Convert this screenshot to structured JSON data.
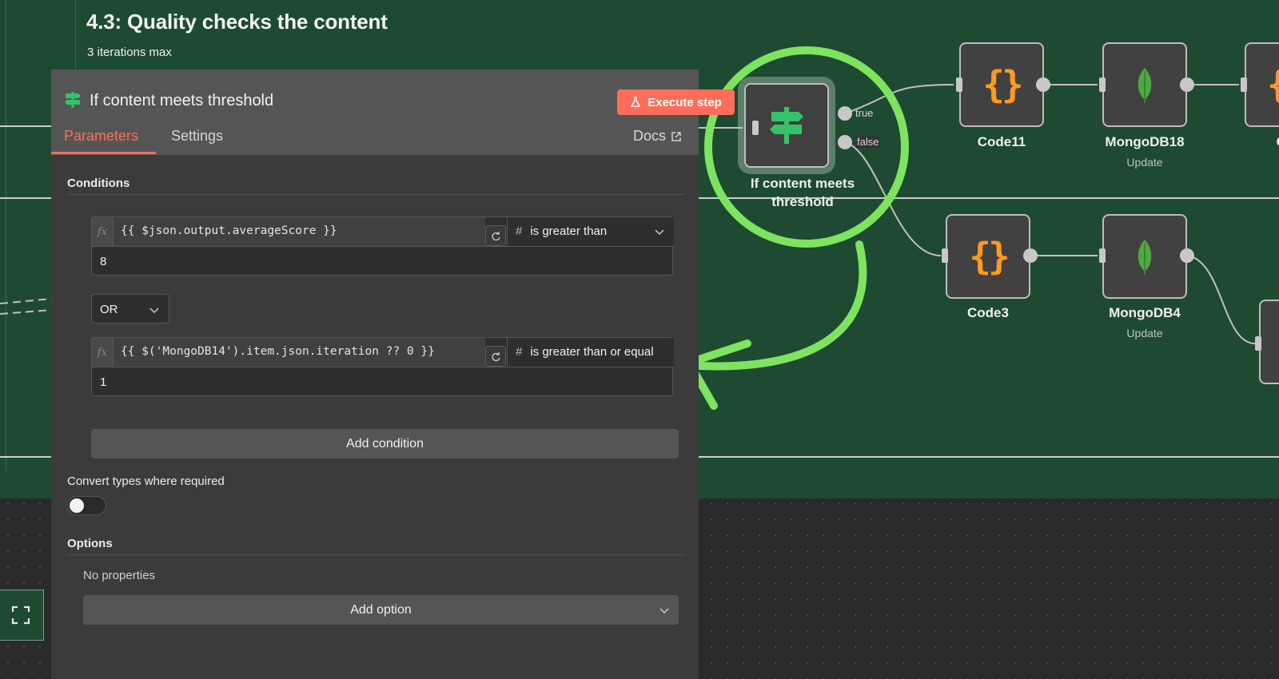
{
  "sticky": {
    "title": "4.3: Quality checks the content",
    "subtitle": "3 iterations max"
  },
  "panel": {
    "title": "If content meets threshold",
    "execute_label": "Execute step",
    "tabs": [
      {
        "label": "Parameters",
        "active": true
      },
      {
        "label": "Settings",
        "active": false
      }
    ],
    "docs_label": "Docs",
    "conditions_heading": "Conditions",
    "conditions": [
      {
        "expression": "{{ $json.output.averageScore }}",
        "type_icon": "#",
        "operator": "is greater than",
        "value": "8"
      },
      {
        "expression": "{{ $('MongoDB14').item.json.iteration ?? 0 }}",
        "type_icon": "#",
        "operator": "is greater than or equal",
        "value": "1"
      }
    ],
    "combinator": "OR",
    "fx_label": "fx",
    "add_condition_label": "Add condition",
    "convert_types_label": "Convert types where required",
    "convert_types_enabled": false,
    "options_heading": "Options",
    "no_properties_label": "No properties",
    "add_option_label": "Add option"
  },
  "nodes": {
    "if_node": {
      "label_line1": "If content meets",
      "label_line2": "threshold",
      "true_label": "true",
      "false_label": "false"
    },
    "code11": {
      "label": "Code11"
    },
    "mongodb18": {
      "label": "MongoDB18",
      "subtitle": "Update"
    },
    "co_partial": {
      "label": "Co"
    },
    "code3": {
      "label": "Code3"
    },
    "mongodb4": {
      "label": "MongoDB4",
      "subtitle": "Update"
    }
  },
  "colors": {
    "accent": "#ff6d5a",
    "sticky_green": "#1e4a31",
    "annotation_green": "#7ee35f",
    "if_icon_green": "#35c36a",
    "code_orange": "#ff9a1f",
    "mongo_green": "#4faa41"
  },
  "icons": {
    "if_node": "signpost-icon",
    "code": "curly-braces-icon",
    "mongodb": "mongodb-leaf-icon",
    "execute": "flask-icon",
    "docs": "external-link-icon",
    "refresh": "refresh-icon",
    "dropdown": "chevron-down-icon",
    "fit_view": "fit-view-icon"
  }
}
